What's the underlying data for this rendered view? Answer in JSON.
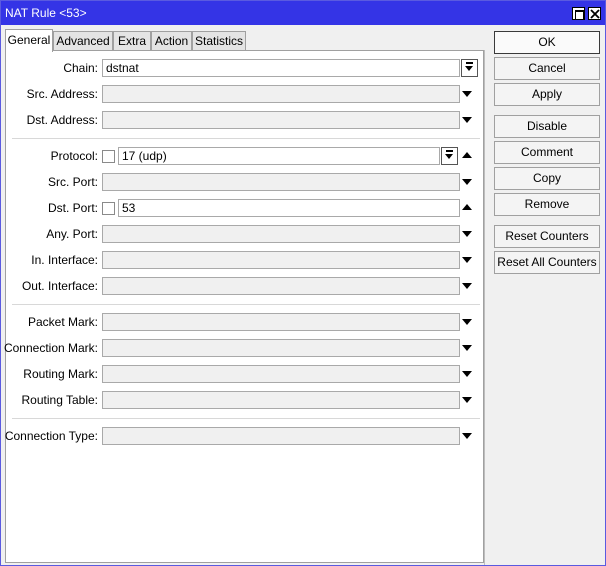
{
  "window": {
    "title": "NAT Rule <53>"
  },
  "tabs": [
    {
      "label": "General",
      "active": true
    },
    {
      "label": "Advanced",
      "active": false
    },
    {
      "label": "Extra",
      "active": false
    },
    {
      "label": "Action",
      "active": false
    },
    {
      "label": "Statistics",
      "active": false
    }
  ],
  "fields": {
    "chain": {
      "label": "Chain:",
      "value": "dstnat"
    },
    "src_address": {
      "label": "Src. Address:",
      "value": ""
    },
    "dst_address": {
      "label": "Dst. Address:",
      "value": ""
    },
    "protocol": {
      "label": "Protocol:",
      "value": "17 (udp)"
    },
    "src_port": {
      "label": "Src. Port:",
      "value": ""
    },
    "dst_port": {
      "label": "Dst. Port:",
      "value": "53"
    },
    "any_port": {
      "label": "Any. Port:",
      "value": ""
    },
    "in_interface": {
      "label": "In. Interface:",
      "value": ""
    },
    "out_interface": {
      "label": "Out. Interface:",
      "value": ""
    },
    "packet_mark": {
      "label": "Packet Mark:",
      "value": ""
    },
    "connection_mark": {
      "label": "Connection Mark:",
      "value": ""
    },
    "routing_mark": {
      "label": "Routing Mark:",
      "value": ""
    },
    "routing_table": {
      "label": "Routing Table:",
      "value": ""
    },
    "connection_type": {
      "label": "Connection Type:",
      "value": ""
    }
  },
  "buttons": {
    "ok": "OK",
    "cancel": "Cancel",
    "apply": "Apply",
    "disable": "Disable",
    "comment": "Comment",
    "copy": "Copy",
    "remove": "Remove",
    "reset_counters": "Reset Counters",
    "reset_all_counters": "Reset All Counters"
  },
  "colors": {
    "titlebar": "#3434e6",
    "titlebar_text": "#ffffff"
  }
}
